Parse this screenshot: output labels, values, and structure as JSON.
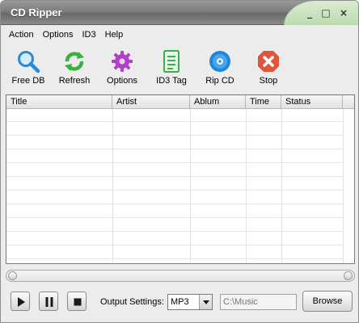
{
  "window": {
    "title": "CD Ripper",
    "controls": {
      "minimize": "_",
      "maximize": "□",
      "close": "×"
    }
  },
  "menu": [
    "Action",
    "Options",
    "ID3",
    "Help"
  ],
  "toolbar": [
    {
      "label": "Free DB",
      "icon": "magnifier-icon",
      "color": "#2a8ad4"
    },
    {
      "label": "Refresh",
      "icon": "refresh-icon",
      "color": "#3cb03c"
    },
    {
      "label": "Options",
      "icon": "gear-icon",
      "color": "#b040c8"
    },
    {
      "label": "ID3 Tag",
      "icon": "document-icon",
      "color": "#3cae52"
    },
    {
      "label": "Rip CD",
      "icon": "disc-icon",
      "color": "#1f86d8"
    },
    {
      "label": "Stop",
      "icon": "stop-icon",
      "color": "#e2553a"
    }
  ],
  "table": {
    "columns": [
      "Title",
      "Artist",
      "Ablum",
      "Time",
      "Status"
    ],
    "rows": []
  },
  "output": {
    "label": "Output Settings:",
    "format": "MP3",
    "path_placeholder": "C:\\Music",
    "browse_label": "Browse"
  },
  "colors": {
    "titlebar": "#7c7c7c",
    "leaf": "#bedbb0",
    "panel": "#ececec"
  }
}
